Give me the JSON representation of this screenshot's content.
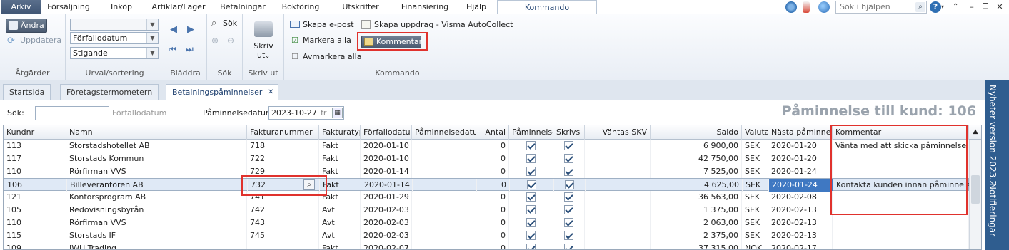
{
  "menu": {
    "tabs": [
      "Arkiv",
      "Försäljning",
      "Inköp",
      "Artiklar/Lager",
      "Betalningar",
      "Bokföring",
      "Utskrifter",
      "Finansiering",
      "Hjälp",
      "Kommando"
    ],
    "help_placeholder": "Sök i hjälpen"
  },
  "ribbon": {
    "andra": "Ändra",
    "uppdatera": "Uppdatera",
    "atgarder": "Åtgärder",
    "sel1": "",
    "sel2": "Förfallodatum",
    "sel3": "Stigande",
    "urval": "Urval/sortering",
    "bladdra": "Bläddra",
    "sok_btn": "Sök",
    "sok_grp": "Sök",
    "skriv_l1": "Skriv",
    "skriv_l2": "ut",
    "skriv_grp": "Skriv ut",
    "skapa_epost": "Skapa e-post",
    "markera_alla": "Markera alla",
    "avmarkera_alla": "Avmarkera alla",
    "skapa_uppdrag": "Skapa uppdrag - Visma AutoCollect",
    "kommentar": "Kommentar",
    "kommando_grp": "Kommando"
  },
  "doc_tabs": [
    "Startsida",
    "Företagstermometern",
    "Betalningspåminnelser"
  ],
  "toolbar": {
    "sok_label": "Sök:",
    "sok_hint": "Förfallodatum",
    "pdatum_label": "Påminnelsedatum:",
    "pdatum_value": "2023-10-27",
    "pdatum_day": "fr",
    "big_title": "Påminnelse till kund: 106"
  },
  "grid": {
    "headers": [
      "Kundnr",
      "Namn",
      "Fakturanummer",
      "Fakturatyp",
      "Förfallodatum",
      "Påminnelsedatum",
      "Antal",
      "Påminnelse",
      "Skrivs",
      "Väntas SKV",
      "Saldo",
      "Valuta",
      "Nästa påminnelse",
      "Kommentar"
    ],
    "rows": [
      [
        "113",
        "Storstadshotellet AB",
        "718",
        "Fakt",
        "2020-01-10",
        "",
        "0",
        true,
        true,
        "",
        "6 900,00",
        "SEK",
        "2020-01-20",
        "Vänta med att skicka påminnelse!"
      ],
      [
        "117",
        "Storstads Kommun",
        "722",
        "Fakt",
        "2020-01-10",
        "",
        "0",
        true,
        true,
        "",
        "42 750,00",
        "SEK",
        "2020-01-20",
        ""
      ],
      [
        "110",
        "Rörfirman VVS",
        "729",
        "Fakt",
        "2020-01-14",
        "",
        "0",
        true,
        true,
        "",
        "7 525,00",
        "SEK",
        "2020-01-24",
        ""
      ],
      [
        "106",
        "Billeverantören AB",
        "732",
        "Fakt",
        "2020-01-14",
        "",
        "0",
        true,
        true,
        "",
        "4 625,00",
        "SEK",
        "2020-01-24",
        "Kontakta kunden innan påminnelse."
      ],
      [
        "121",
        "Kontorsprogram AB",
        "741",
        "Fakt",
        "2020-01-29",
        "",
        "0",
        true,
        true,
        "",
        "36 563,00",
        "SEK",
        "2020-02-08",
        ""
      ],
      [
        "105",
        "Redovisningsbyrån",
        "742",
        "Avt",
        "2020-02-03",
        "",
        "0",
        true,
        true,
        "",
        "1 375,00",
        "SEK",
        "2020-02-13",
        ""
      ],
      [
        "110",
        "Rörfirman VVS",
        "743",
        "Avt",
        "2020-02-03",
        "",
        "0",
        true,
        true,
        "",
        "2 063,00",
        "SEK",
        "2020-02-13",
        ""
      ],
      [
        "115",
        "Storstads IF",
        "745",
        "Avt",
        "2020-02-03",
        "",
        "0",
        true,
        true,
        "",
        "2 375,00",
        "SEK",
        "2020-02-13",
        ""
      ],
      [
        "109",
        "IWU Trading",
        "",
        "Fakt",
        "2020-02-07",
        "",
        "0",
        true,
        true,
        "",
        "37 315,00",
        "NOK",
        "2020-02-17",
        ""
      ]
    ]
  },
  "side": {
    "nyheter": "Nyheter version 2023.2",
    "notifieringar": "Notifieringar"
  }
}
